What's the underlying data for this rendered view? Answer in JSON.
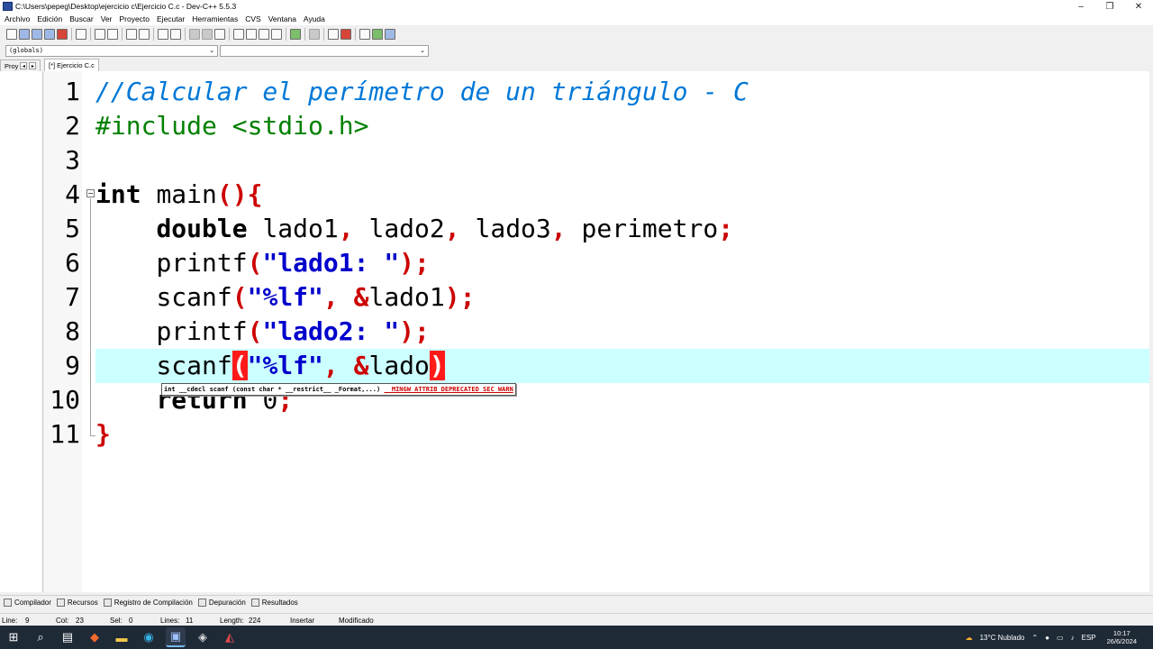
{
  "window": {
    "title": "C:\\Users\\pepeg\\Desktop\\ejercicio  c\\Ejercicio C.c - Dev-C++ 5.5.3",
    "controls": {
      "minimize": "–",
      "maximize": "❐",
      "close": "✕"
    }
  },
  "menu": [
    "Archivo",
    "Edición",
    "Buscar",
    "Ver",
    "Proyecto",
    "Ejecutar",
    "Herramientas",
    "CVS",
    "Ventana",
    "Ayuda"
  ],
  "scope": {
    "left": "(globals)",
    "right": ""
  },
  "tabs": {
    "project": "Proy",
    "file": "[*] Ejercicio C.c"
  },
  "editor": {
    "line_numbers": [
      "1",
      "2",
      "3",
      "4",
      "5",
      "6",
      "7",
      "8",
      "9",
      "10",
      "11"
    ],
    "current_line": 9,
    "lines": {
      "l1": {
        "comment": "//Calcular el perímetro de un triángulo - C"
      },
      "l2": {
        "pre": "#include <stdio.h>"
      },
      "l4": {
        "kw": "int",
        "sp": " ",
        "name": "main",
        "paren": "()",
        "brace": "{"
      },
      "l5": {
        "indent": "    ",
        "kw": "double",
        "a": " lado1",
        "c1": ",",
        "b": " lado2",
        "c2": ",",
        "c": " lado3",
        "c3": ",",
        "d": " perimetro",
        "semi": ";"
      },
      "l6": {
        "indent": "    ",
        "fn": "printf",
        "open": "(",
        "str": "\"lado1: \"",
        "close": ")",
        "semi": ";"
      },
      "l7": {
        "indent": "    ",
        "fn": "scanf",
        "open": "(",
        "str": "\"%lf\"",
        "comma": ",",
        "amp": " &",
        "var": "lado1",
        "close": ")",
        "semi": ";"
      },
      "l8": {
        "indent": "    ",
        "fn": "printf",
        "open": "(",
        "str": "\"lado2: \"",
        "close": ")",
        "semi": ";"
      },
      "l9": {
        "indent": "    ",
        "fn": "scanf",
        "open": "(",
        "str": "\"%lf\"",
        "comma": ",",
        "amp": " &",
        "var": "lado",
        "close": ")"
      },
      "l10": {
        "indent": "    ",
        "kw": "return",
        "val": " 0",
        "semi": ";"
      },
      "l11": {
        "brace": "}"
      }
    },
    "fold_marker": "−",
    "tooltip": {
      "prefix": "int __cdecl ",
      "fn": "scanf",
      "args": " (const char * __restrict__ _Format,...) ",
      "macro": "__MINGW_ATTRIB_DEPRECATED_SEC_WARN"
    }
  },
  "bottom_tabs": [
    "Compilador",
    "Recursos",
    "Registro de Compilación",
    "Depuración",
    "Resultados"
  ],
  "status": {
    "line_label": "Line:",
    "line": "9",
    "col_label": "Col:",
    "col": "23",
    "sel_label": "Sel:",
    "sel": "0",
    "lines_label": "Lines:",
    "lines": "11",
    "length_label": "Length:",
    "length": "224",
    "mode": "Insertar",
    "modified": "Modificado"
  },
  "taskbar": {
    "weather": "13°C  Nublado",
    "lang": "ESP",
    "time": "10:17",
    "date": "26/6/2024"
  },
  "icons": {
    "start": "windows-start-icon",
    "search": "search-icon",
    "taskview": "task-view-icon"
  }
}
